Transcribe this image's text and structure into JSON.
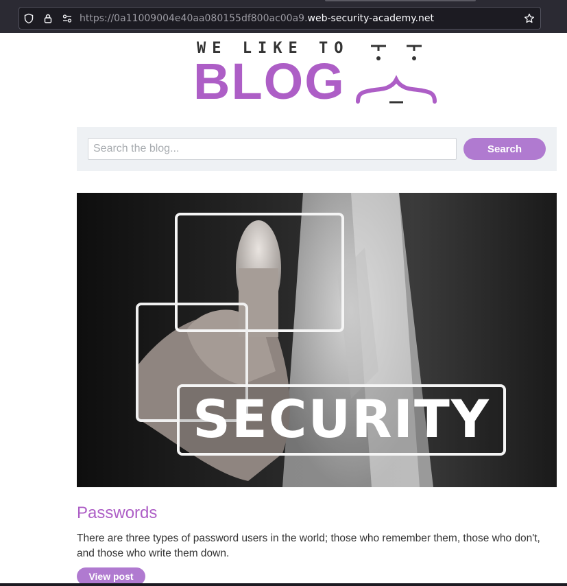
{
  "browser": {
    "url_prefix": "https://0a11009004e40aa080155df800ac00a9.",
    "url_domain": "web-security-academy.net",
    "icons": [
      "shield-icon",
      "lock-icon",
      "permissions-icon",
      "bookmark-star-icon"
    ]
  },
  "logo": {
    "tagline": "WE LIKE TO",
    "word": "BLOG"
  },
  "search": {
    "placeholder": "Search the blog...",
    "button_label": "Search"
  },
  "post": {
    "image_text": "SECURITY",
    "title": "Passwords",
    "summary": "There are three types of password users in the world; those who remember them, those who don't, and those who write them down.",
    "view_label": "View post"
  },
  "colors": {
    "accent": "#ad5ec6",
    "button": "#b07ad0",
    "panel": "#eef1f4"
  }
}
